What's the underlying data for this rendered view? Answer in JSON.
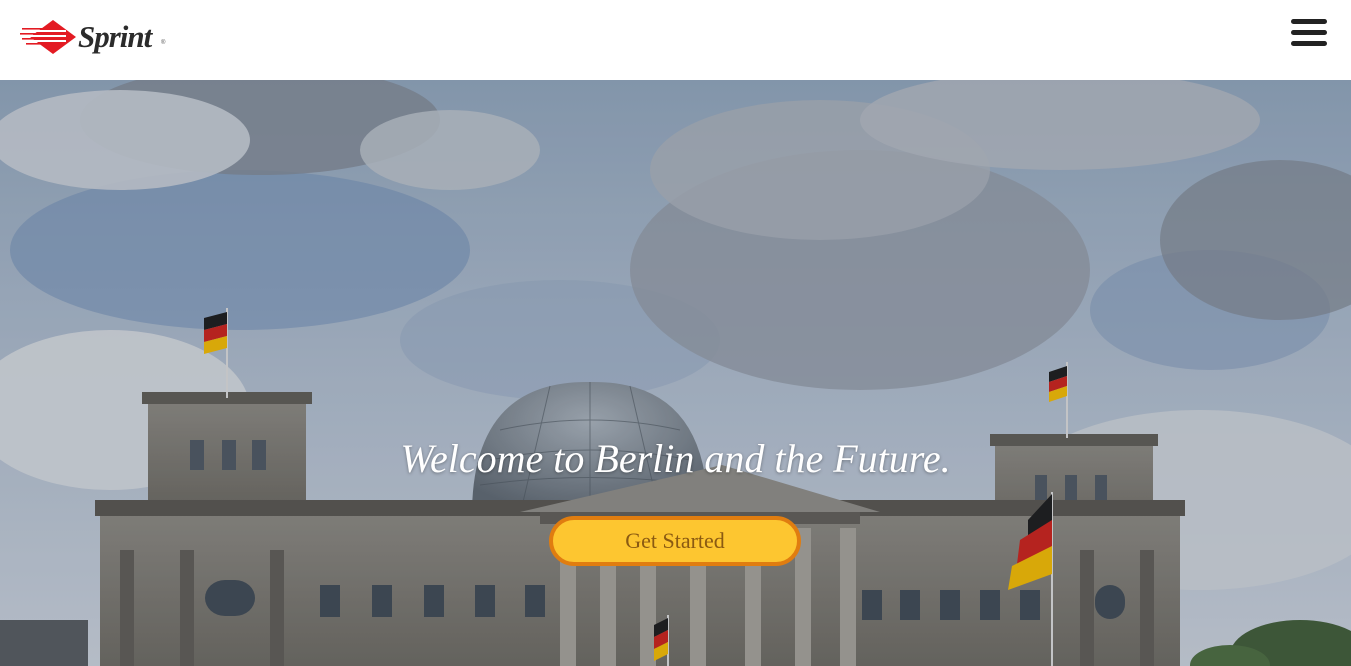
{
  "header": {
    "brand": "Sprint",
    "brand_mark": "®",
    "logo_icon": "sprint-diamond-logo",
    "menu_icon": "hamburger-menu-icon"
  },
  "hero": {
    "title": "Welcome to Berlin and the Future.",
    "cta_label": "Get Started",
    "background_image": "reichstag-building-berlin-with-german-flags"
  },
  "colors": {
    "logo_red": "#e31b23",
    "cta_fill": "#fdc630",
    "cta_border": "#e07d10",
    "cta_text": "#8a5a12",
    "hero_text": "#ffffff"
  }
}
